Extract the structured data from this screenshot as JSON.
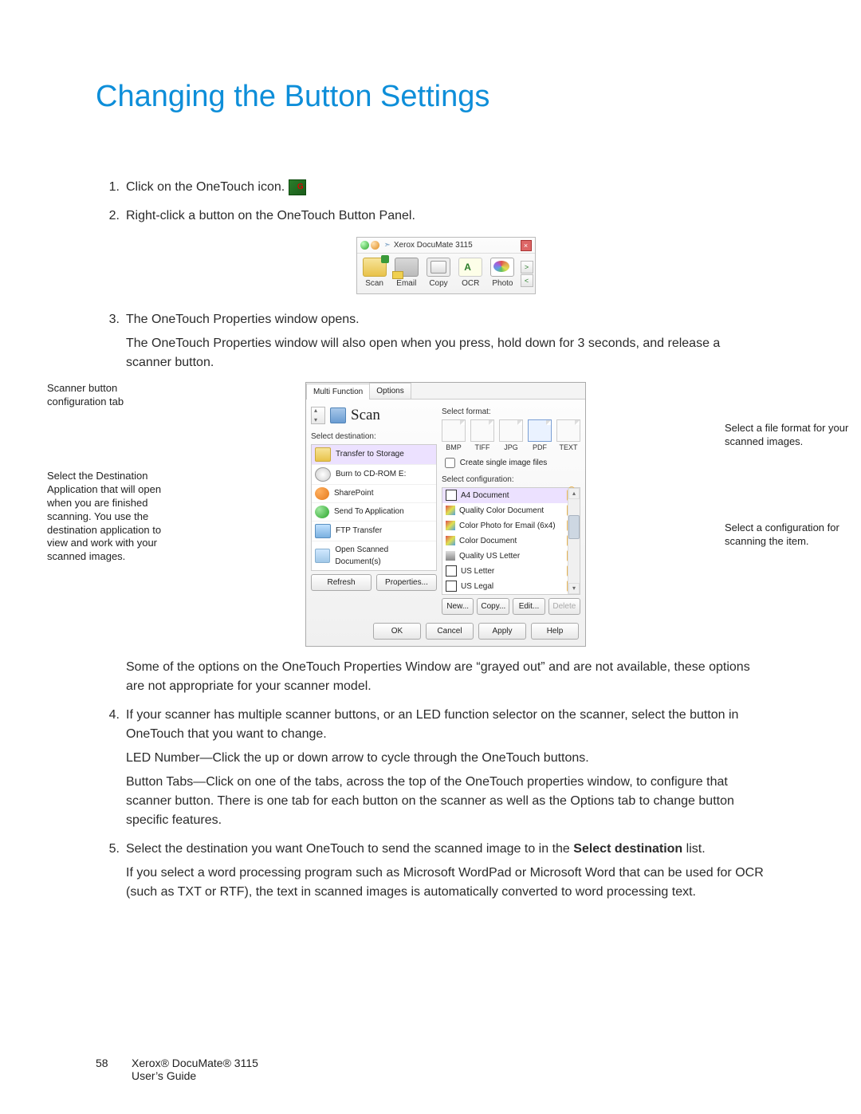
{
  "title": "Changing the Button Settings",
  "steps": {
    "s1": {
      "num": "1.",
      "text": "Click on the OneTouch icon."
    },
    "s2": {
      "num": "2.",
      "text": "Right-click a button on the OneTouch Button Panel."
    },
    "s3": {
      "num": "3.",
      "p1": "The OneTouch Properties window opens.",
      "p2": "The OneTouch Properties window will also open when you press, hold down for 3 seconds, and release a scanner button."
    },
    "s3b": {
      "p1": "Some of the options on the OneTouch Properties Window are “grayed out” and are not available, these options are not appropriate for your scanner model."
    },
    "s4": {
      "num": "4.",
      "p1": "If your scanner has multiple scanner buttons, or an LED function selector on the scanner, select the button in OneTouch that you want to change.",
      "p2": "LED Number—Click the up or down arrow to cycle through the OneTouch buttons.",
      "p3": "Button Tabs—Click on one of the tabs, across the top of the OneTouch properties window, to configure that scanner button. There is one tab for each button on the scanner as well as the Options tab to change button specific features."
    },
    "s5": {
      "num": "5.",
      "p1a": "Select the destination you want OneTouch to send the scanned image to in the ",
      "p1b": "Select destination",
      "p1c": " list.",
      "p2": "If you select a word processing program such as Microsoft WordPad or Microsoft Word that can be used for OCR (such as TXT or RTF), the text in scanned images is automatically converted to word processing text."
    }
  },
  "panel": {
    "title": "Xerox DocuMate 3115",
    "buttons": [
      "Scan",
      "Email",
      "Copy",
      "OCR",
      "Photo"
    ]
  },
  "annot": {
    "l1": "Scanner button configuration tab",
    "l2": "Select the Destination Application that will open when you are finished scanning. You use the destination application to view and work with your scanned images.",
    "r1": "Select a file format for your scanned images.",
    "r2": "Select a configuration for scanning the item."
  },
  "props": {
    "tabs": {
      "t1": "Multi Function",
      "t2": "Options"
    },
    "scanLabel": "Scan",
    "selDest": "Select destination:",
    "dest": {
      "d1": "Transfer to Storage",
      "d2": "Burn to CD-ROM E:",
      "d3": "SharePoint",
      "d4": "Send To Application",
      "d5": "FTP Transfer",
      "d6": "Open Scanned Document(s)"
    },
    "btns": {
      "refresh": "Refresh",
      "properties": "Properties...",
      "new": "New...",
      "copy": "Copy...",
      "edit": "Edit...",
      "delete": "Delete"
    },
    "selFmt": "Select format:",
    "fmt": {
      "f1": "BMP",
      "f2": "TIFF",
      "f3": "JPG",
      "f4": "PDF",
      "f5": "TEXT"
    },
    "singleFiles": "Create single image files",
    "selCfg": "Select configuration:",
    "cfg": {
      "c1": "A4 Document",
      "c2": "Quality Color Document",
      "c3": "Color Photo for Email (6x4)",
      "c4": "Color Document",
      "c5": "Quality US Letter",
      "c6": "US Letter",
      "c7": "US Legal"
    },
    "bottom": {
      "ok": "OK",
      "cancel": "Cancel",
      "apply": "Apply",
      "help": "Help"
    }
  },
  "footer": {
    "page": "58",
    "l1": "Xerox® DocuMate® 3115",
    "l2": "User’s Guide"
  }
}
